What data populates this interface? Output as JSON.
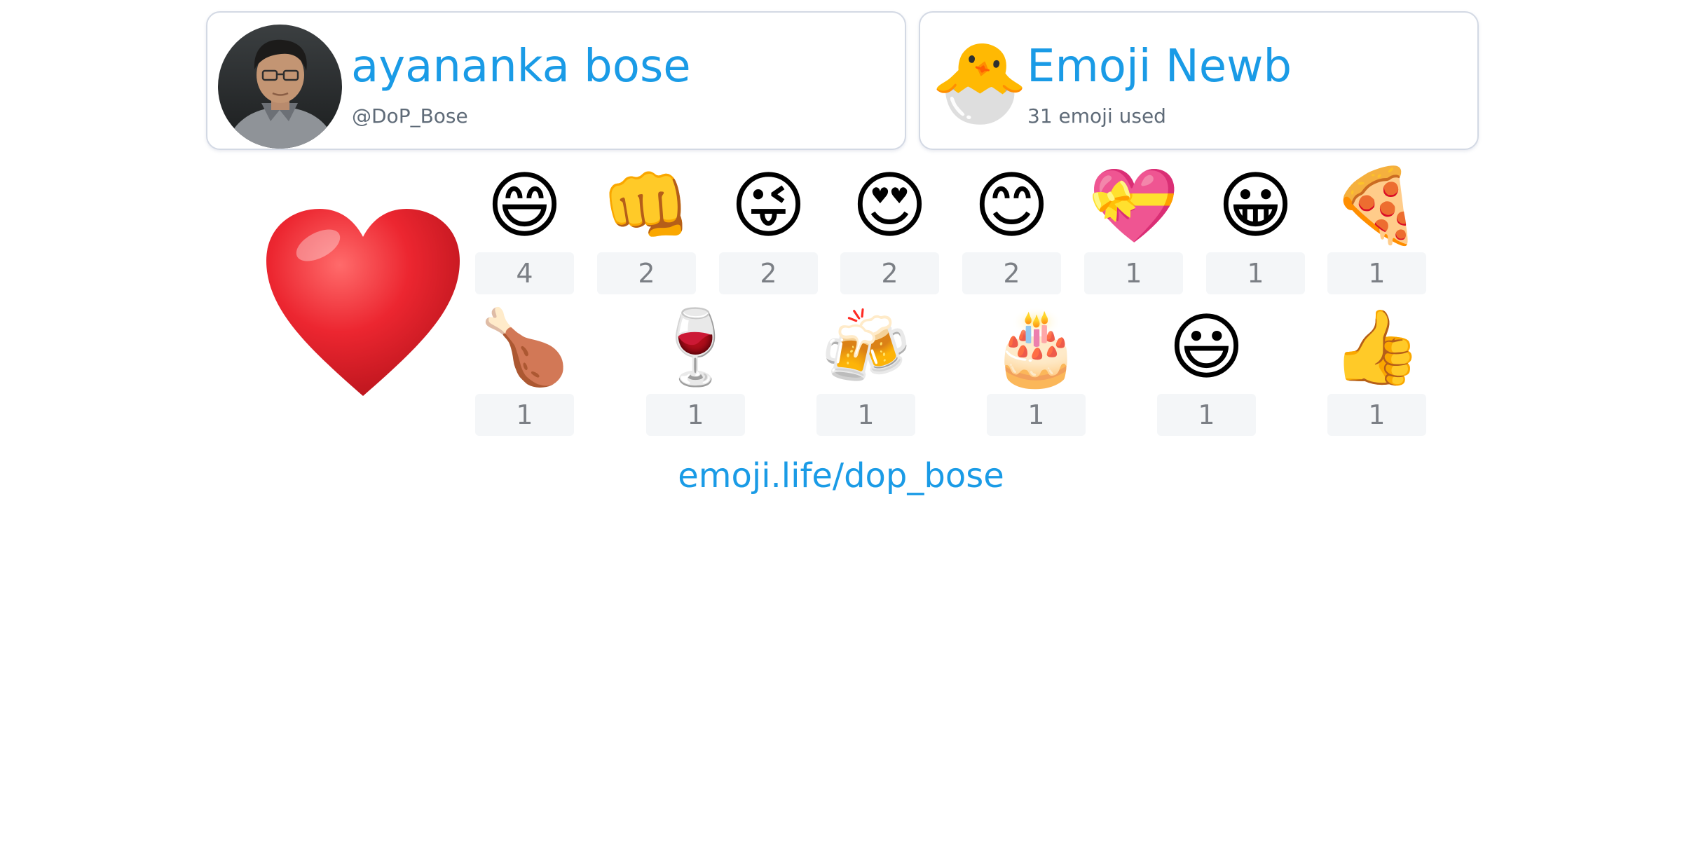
{
  "profile": {
    "display_name": "ayananka bose",
    "handle": "@DoP_Bose",
    "avatar": "profile-photo"
  },
  "rank": {
    "title": "Emoji Newb",
    "emoji": "🐣",
    "subtitle": "31 emoji used"
  },
  "top_emoji": {
    "emoji": "❤️",
    "name": "red-heart-icon"
  },
  "emoji_counts": {
    "row1": [
      {
        "emoji": "😄",
        "name": "grinning-smiling-eyes-icon",
        "count": "4"
      },
      {
        "emoji": "👊",
        "name": "fist-bump-icon",
        "count": "2"
      },
      {
        "emoji": "😜",
        "name": "winking-tongue-icon",
        "count": "2"
      },
      {
        "emoji": "😍",
        "name": "heart-eyes-icon",
        "count": "2"
      },
      {
        "emoji": "😊",
        "name": "smiling-blush-icon",
        "count": "2"
      },
      {
        "emoji": "💝",
        "name": "heart-ribbon-icon",
        "count": "1"
      },
      {
        "emoji": "😀",
        "name": "grinning-face-icon",
        "count": "1"
      },
      {
        "emoji": "🍕",
        "name": "pizza-icon",
        "count": "1"
      }
    ],
    "row2": [
      {
        "emoji": "🍗",
        "name": "poultry-leg-icon",
        "count": "1"
      },
      {
        "emoji": "🍷",
        "name": "wine-glass-icon",
        "count": "1"
      },
      {
        "emoji": "🍻",
        "name": "clinking-beers-icon",
        "count": "1"
      },
      {
        "emoji": "🎂",
        "name": "birthday-cake-icon",
        "count": "1"
      },
      {
        "emoji": "😃",
        "name": "smiley-face-icon",
        "count": "1"
      },
      {
        "emoji": "👍",
        "name": "thumbs-up-icon",
        "count": "1"
      }
    ]
  },
  "footer": {
    "link_text": "emoji.life/dop_bose"
  },
  "colors": {
    "accent": "#1a9be6",
    "muted_text": "#5f6b78",
    "count_bg": "#f4f6f8",
    "card_border": "#d3d9e4",
    "heart": "#e8232c"
  }
}
